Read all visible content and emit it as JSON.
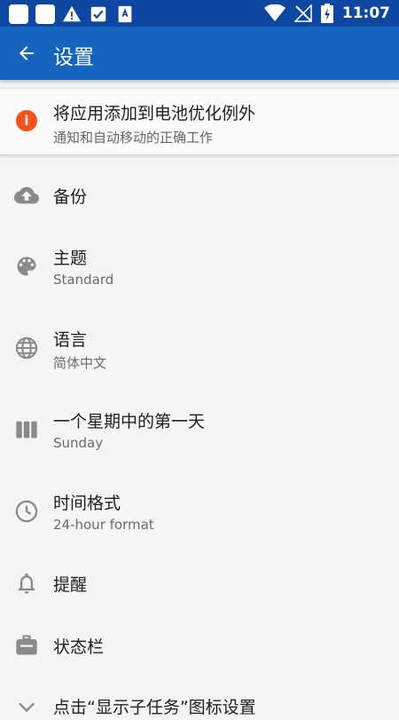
{
  "status_bar": {
    "time": "11:07"
  },
  "app_bar": {
    "title": "设置"
  },
  "battery_card": {
    "title": "将应用添加到电池优化例外",
    "subtitle": "通知和自动移动的正确工作",
    "badge": "i"
  },
  "settings": [
    {
      "id": "backup",
      "icon": "cloud-upload-icon",
      "title": "备份"
    },
    {
      "id": "theme",
      "icon": "palette-icon",
      "title": "主题",
      "subtitle": "Standard"
    },
    {
      "id": "language",
      "icon": "globe-icon",
      "title": "语言",
      "subtitle": "简体中文"
    },
    {
      "id": "first-day",
      "icon": "view-week-icon",
      "title": "一个星期中的第一天",
      "subtitle": "Sunday"
    },
    {
      "id": "time-format",
      "icon": "clock-icon",
      "title": "时间格式",
      "subtitle": "24-hour format"
    },
    {
      "id": "reminders",
      "icon": "bell-icon",
      "title": "提醒"
    },
    {
      "id": "status-bar",
      "icon": "toolbox-icon",
      "title": "状态栏"
    },
    {
      "id": "subtask-icon",
      "icon": "chevron-down-icon",
      "title": "点击“显示子任务”图标设置"
    }
  ],
  "colors": {
    "status_bar": "#0d47a1",
    "app_bar": "#1565c0",
    "warning_badge": "#f4511e",
    "icon_gray": "#8a8a8a"
  }
}
